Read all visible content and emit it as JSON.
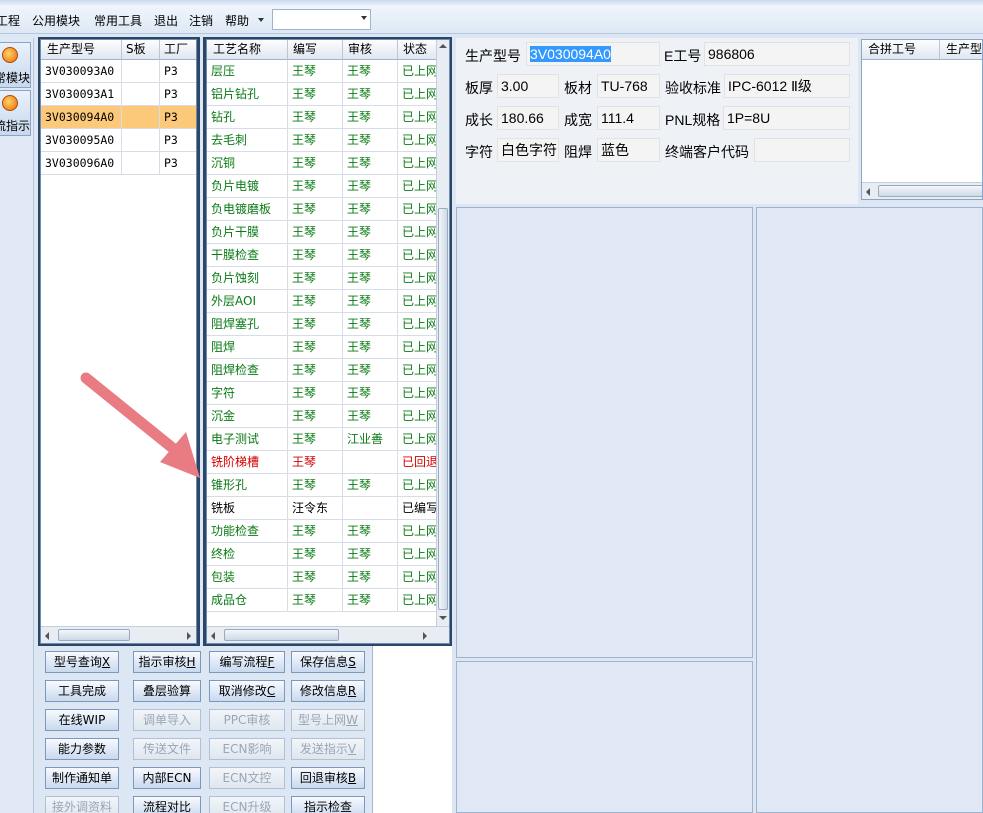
{
  "menubar": {
    "items": [
      "工程",
      "公用模块",
      "常用工具",
      "退出",
      "注销",
      "帮助"
    ],
    "combo_value": ""
  },
  "leftnav": {
    "items": [
      {
        "label": "常模块",
        "icon": "module-icon"
      },
      {
        "label": "流指示",
        "icon": "indicator-icon"
      }
    ]
  },
  "model_grid": {
    "headers": [
      "生产型号",
      "S板",
      "工厂"
    ],
    "rows": [
      {
        "model": "3V030093A0",
        "s": "",
        "factory": "P3"
      },
      {
        "model": "3V030093A1",
        "s": "",
        "factory": "P3"
      },
      {
        "model": "3V030094A0",
        "s": "",
        "factory": "P3",
        "selected": true
      },
      {
        "model": "3V030095A0",
        "s": "",
        "factory": "P3"
      },
      {
        "model": "3V030096A0",
        "s": "",
        "factory": "P3"
      }
    ]
  },
  "process_grid": {
    "headers": [
      "工艺名称",
      "编写",
      "审核",
      "状态"
    ],
    "rows": [
      {
        "name": "层压",
        "author": "王琴",
        "reviewer": "王琴",
        "status": "已上网",
        "style": "ok"
      },
      {
        "name": "铝片钻孔",
        "author": "王琴",
        "reviewer": "王琴",
        "status": "已上网",
        "style": "ok"
      },
      {
        "name": "钻孔",
        "author": "王琴",
        "reviewer": "王琴",
        "status": "已上网",
        "style": "ok"
      },
      {
        "name": "去毛刺",
        "author": "王琴",
        "reviewer": "王琴",
        "status": "已上网",
        "style": "ok"
      },
      {
        "name": "沉铜",
        "author": "王琴",
        "reviewer": "王琴",
        "status": "已上网",
        "style": "ok"
      },
      {
        "name": "负片电镀",
        "author": "王琴",
        "reviewer": "王琴",
        "status": "已上网",
        "style": "ok"
      },
      {
        "name": "负电镀磨板",
        "author": "王琴",
        "reviewer": "王琴",
        "status": "已上网",
        "style": "ok"
      },
      {
        "name": "负片干膜",
        "author": "王琴",
        "reviewer": "王琴",
        "status": "已上网",
        "style": "ok"
      },
      {
        "name": "干膜检查",
        "author": "王琴",
        "reviewer": "王琴",
        "status": "已上网",
        "style": "ok"
      },
      {
        "name": "负片蚀刻",
        "author": "王琴",
        "reviewer": "王琴",
        "status": "已上网",
        "style": "ok"
      },
      {
        "name": "外层AOI",
        "author": "王琴",
        "reviewer": "王琴",
        "status": "已上网",
        "style": "ok"
      },
      {
        "name": "阻焊塞孔",
        "author": "王琴",
        "reviewer": "王琴",
        "status": "已上网",
        "style": "ok"
      },
      {
        "name": "阻焊",
        "author": "王琴",
        "reviewer": "王琴",
        "status": "已上网",
        "style": "ok"
      },
      {
        "name": "阻焊检查",
        "author": "王琴",
        "reviewer": "王琴",
        "status": "已上网",
        "style": "ok"
      },
      {
        "name": "字符",
        "author": "王琴",
        "reviewer": "王琴",
        "status": "已上网",
        "style": "ok"
      },
      {
        "name": "沉金",
        "author": "王琴",
        "reviewer": "王琴",
        "status": "已上网",
        "style": "ok"
      },
      {
        "name": "电子测试",
        "author": "王琴",
        "reviewer": "江业善",
        "status": "已上网",
        "style": "ok"
      },
      {
        "name": "铣阶梯槽",
        "author": "王琴",
        "reviewer": "",
        "status": "已回退",
        "style": "red"
      },
      {
        "name": "锥形孔",
        "author": "王琴",
        "reviewer": "王琴",
        "status": "已上网",
        "style": "ok"
      },
      {
        "name": "铣板",
        "author": "汪令东",
        "reviewer": "",
        "status": "已编写",
        "style": "plain"
      },
      {
        "name": "功能检查",
        "author": "王琴",
        "reviewer": "王琴",
        "status": "已上网",
        "style": "ok"
      },
      {
        "name": "终检",
        "author": "王琴",
        "reviewer": "王琴",
        "status": "已上网",
        "style": "ok"
      },
      {
        "name": "包装",
        "author": "王琴",
        "reviewer": "王琴",
        "status": "已上网",
        "style": "ok"
      },
      {
        "name": "成品仓",
        "author": "王琴",
        "reviewer": "王琴",
        "status": "已上网",
        "style": "ok"
      }
    ]
  },
  "buttons": [
    [
      {
        "label": "型号查询",
        "key": "X",
        "enabled": true
      },
      {
        "label": "指示审核",
        "key": "H",
        "enabled": true
      },
      {
        "label": "编写流程",
        "key": "F",
        "enabled": true
      },
      {
        "label": "保存信息",
        "key": "S",
        "enabled": true
      }
    ],
    [
      {
        "label": "工具完成",
        "key": "",
        "enabled": true
      },
      {
        "label": "叠层验算",
        "key": "",
        "enabled": true
      },
      {
        "label": "取消修改",
        "key": "C",
        "enabled": true
      },
      {
        "label": "修改信息",
        "key": "R",
        "enabled": true
      }
    ],
    [
      {
        "label": "在线WIP",
        "key": "",
        "enabled": true
      },
      {
        "label": "调单导入",
        "key": "",
        "enabled": false
      },
      {
        "label": "PPC审核",
        "key": "",
        "enabled": false
      },
      {
        "label": "型号上网",
        "key": "W",
        "enabled": false
      }
    ],
    [
      {
        "label": "能力参数",
        "key": "",
        "enabled": true
      },
      {
        "label": "传送文件",
        "key": "",
        "enabled": false
      },
      {
        "label": "ECN影响",
        "key": "",
        "enabled": false
      },
      {
        "label": "发送指示",
        "key": "V",
        "enabled": false
      }
    ],
    [
      {
        "label": "制作通知单",
        "key": "",
        "enabled": true
      },
      {
        "label": "内部ECN",
        "key": "",
        "enabled": true
      },
      {
        "label": "ECN文控",
        "key": "",
        "enabled": false
      },
      {
        "label": "回退审核",
        "key": "B",
        "enabled": true
      }
    ],
    [
      {
        "label": "接外调资料",
        "key": "",
        "enabled": false
      },
      {
        "label": "流程对比",
        "key": "",
        "enabled": true
      },
      {
        "label": "ECN升级",
        "key": "",
        "enabled": false
      },
      {
        "label": "指示检查",
        "key": "",
        "enabled": true
      }
    ]
  ],
  "info": {
    "model_label": "生产型号",
    "model_value": "3V030094A0",
    "eno_label": "E工号",
    "eno_value": "986806",
    "thickness_label": "板厚",
    "thickness_value": "3.00",
    "material_label": "板材",
    "material_value": "TU-768",
    "standard_label": "验收标准",
    "standard_value": "IPC-6012 Ⅱ级",
    "length_label": "成长",
    "length_value": "180.66",
    "width_label": "成宽",
    "width_value": "111.4",
    "pnl_label": "PNL规格",
    "pnl_value": "1P=8U",
    "char_label": "字符",
    "char_value": "白色字符",
    "mask_label": "阻焊",
    "mask_value": "蓝色",
    "customer_label": "终端客户代码",
    "customer_value": ""
  },
  "merge_grid": {
    "headers": [
      "合拼工号",
      "生产型"
    ]
  },
  "colors": {
    "ok_text": "#0a7a15",
    "returned_text": "#d40000",
    "selected_row": "#fcc97a",
    "selection_highlight": "#3399ff",
    "annotation_arrow": "#e97b82"
  }
}
